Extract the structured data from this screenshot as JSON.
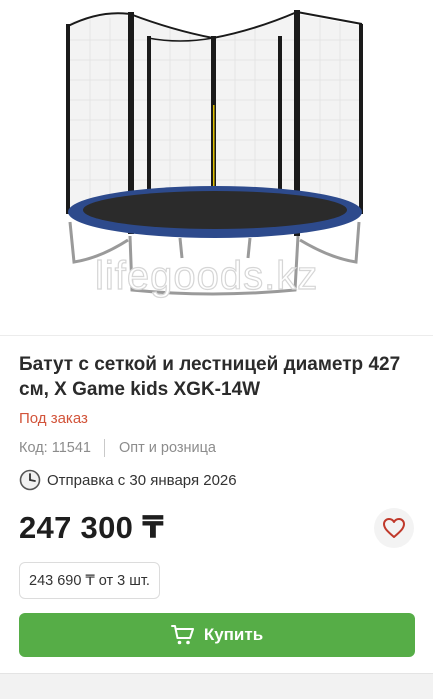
{
  "product": {
    "title": "Батут с сеткой и лестницей диаметр 427 см, X Game kids XGK-14W",
    "image_alt": "Trampoline with safety net",
    "watermark": "lifegoods.kz",
    "availability": "Под заказ",
    "code": "Код: 11541",
    "sale_type": "Опт и розница",
    "shipping": "Отправка с 30 января 2026",
    "price": "247 300 ₸",
    "bulk_price": "243 690 ₸ от 3 шт.",
    "buy_label": "Купить"
  },
  "colors": {
    "buy_button": "#56ad47",
    "availability": "#d2543a",
    "favorite_icon": "#c0392b",
    "trampoline_pad": "#2d4a8c"
  },
  "icons": {
    "shipping": "clock-icon",
    "favorite": "heart-icon",
    "buy": "cart-icon"
  }
}
